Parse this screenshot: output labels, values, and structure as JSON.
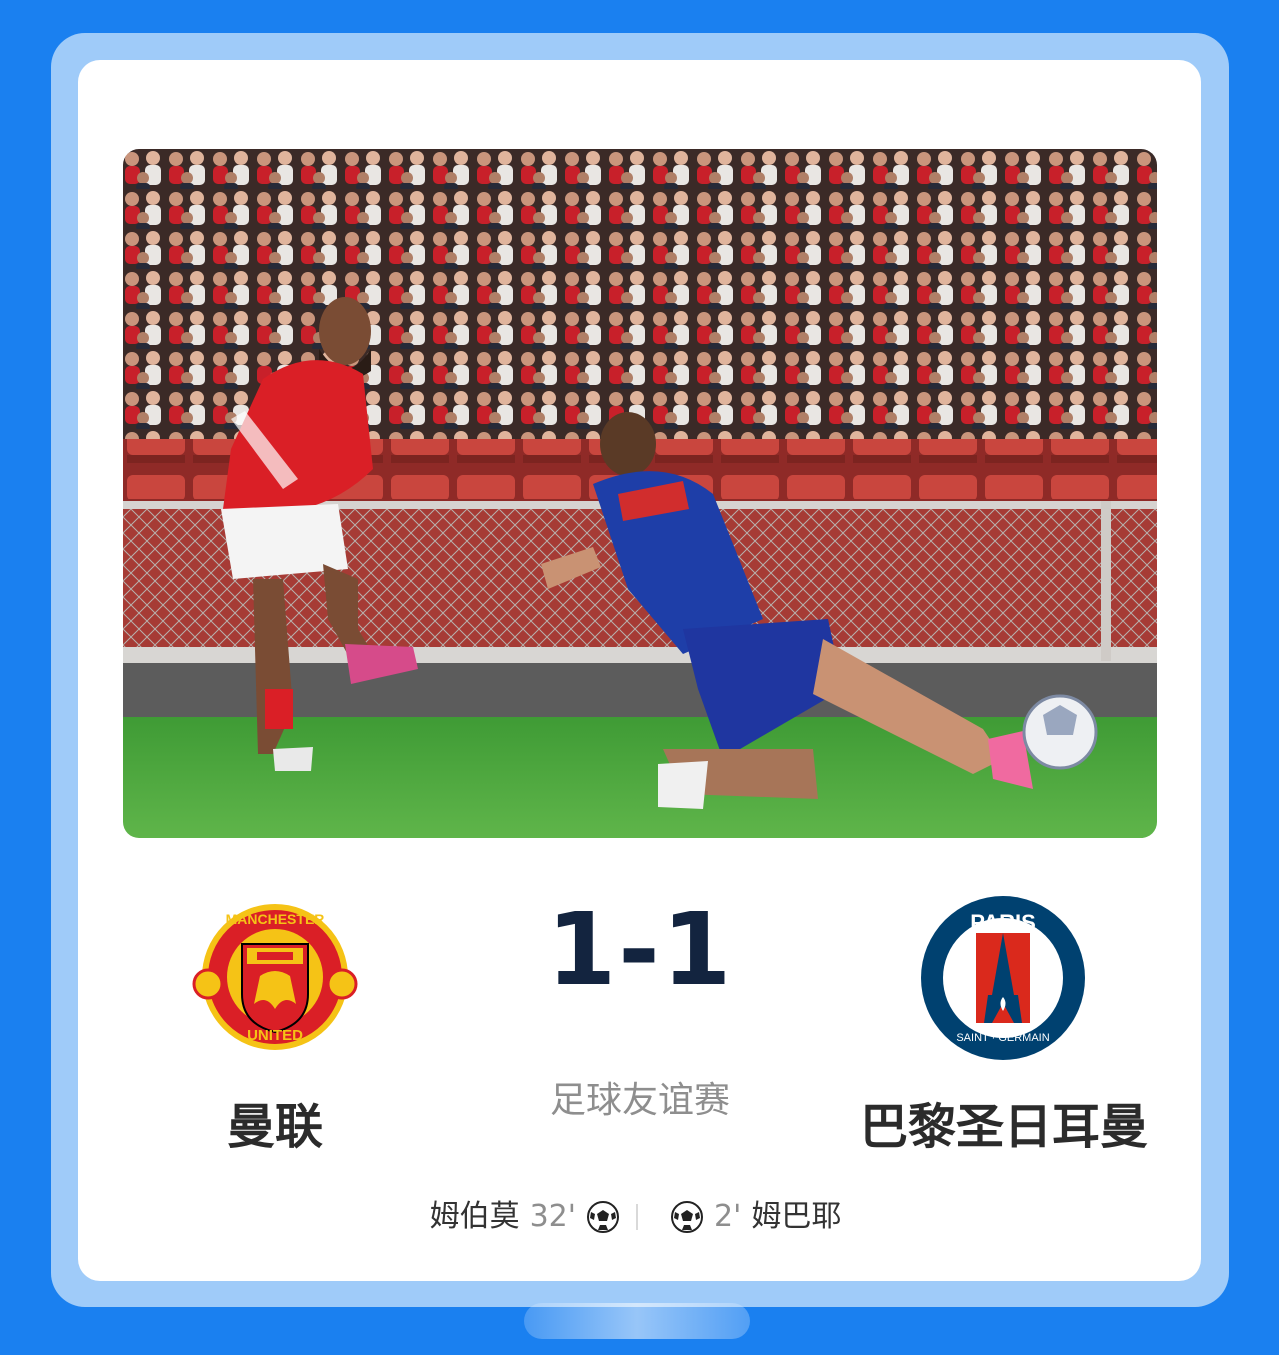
{
  "match": {
    "score": "1-1",
    "match_type": "足球友谊赛",
    "home_team": {
      "name": "曼联",
      "logo_icon": "manchester-united-crest"
    },
    "away_team": {
      "name": "巴黎圣日耳曼",
      "logo_icon": "psg-crest"
    },
    "home_scorer": {
      "player": "姆伯莫",
      "minute": "32'"
    },
    "away_scorer": {
      "player": "姆巴耶",
      "minute": "2'"
    }
  },
  "home_crest": {
    "top_text": "MANCHESTER",
    "bottom_text": "UNITED"
  },
  "away_crest": {
    "top_text": "PARIS",
    "bottom_text": "SAINT · GERMAIN"
  },
  "photo": {
    "subject": "match-action-photo"
  },
  "colors": {
    "background": "#1a80f0",
    "frame": "#9fcbf9",
    "card": "#ffffff",
    "score": "#13243f",
    "muted": "#8e8e8e",
    "team_name": "#2b2b2b",
    "united_red": "#da1f26",
    "united_gold": "#f5c316",
    "psg_navy": "#004170",
    "psg_red": "#da291c"
  }
}
